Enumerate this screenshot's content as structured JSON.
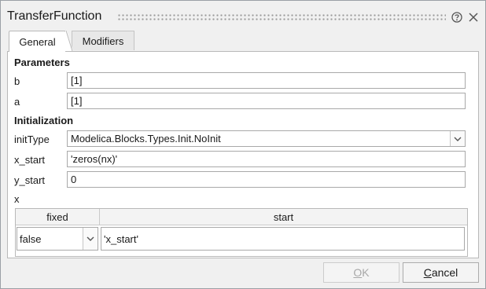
{
  "window": {
    "title": "TransferFunction"
  },
  "tabs": [
    {
      "label": "General",
      "active": true
    },
    {
      "label": "Modifiers",
      "active": false
    }
  ],
  "parameters": {
    "heading": "Parameters",
    "b": {
      "label": "b",
      "value": "[1]"
    },
    "a": {
      "label": "a",
      "value": "[1]"
    }
  },
  "initialization": {
    "heading": "Initialization",
    "initType": {
      "label": "initType",
      "value": "Modelica.Blocks.Types.Init.NoInit"
    },
    "x_start": {
      "label": "x_start",
      "value": "'zeros(nx)'"
    },
    "y_start": {
      "label": "y_start",
      "value": "0"
    },
    "x": {
      "label": "x",
      "columns": [
        "fixed",
        "start"
      ],
      "rows": [
        {
          "fixed": "false",
          "start": "'x_start'"
        }
      ]
    }
  },
  "buttons": {
    "ok_label_accel": "O",
    "ok_label_rest": "K",
    "cancel_label_accel": "C",
    "cancel_label_rest": "ancel"
  },
  "icons": [
    "help-icon",
    "close-icon",
    "chevron-down-icon"
  ],
  "colors": {
    "dialog_bg": "#f0f0f0",
    "panel_bg": "#ffffff",
    "disabled_text": "#a8a8a8"
  }
}
